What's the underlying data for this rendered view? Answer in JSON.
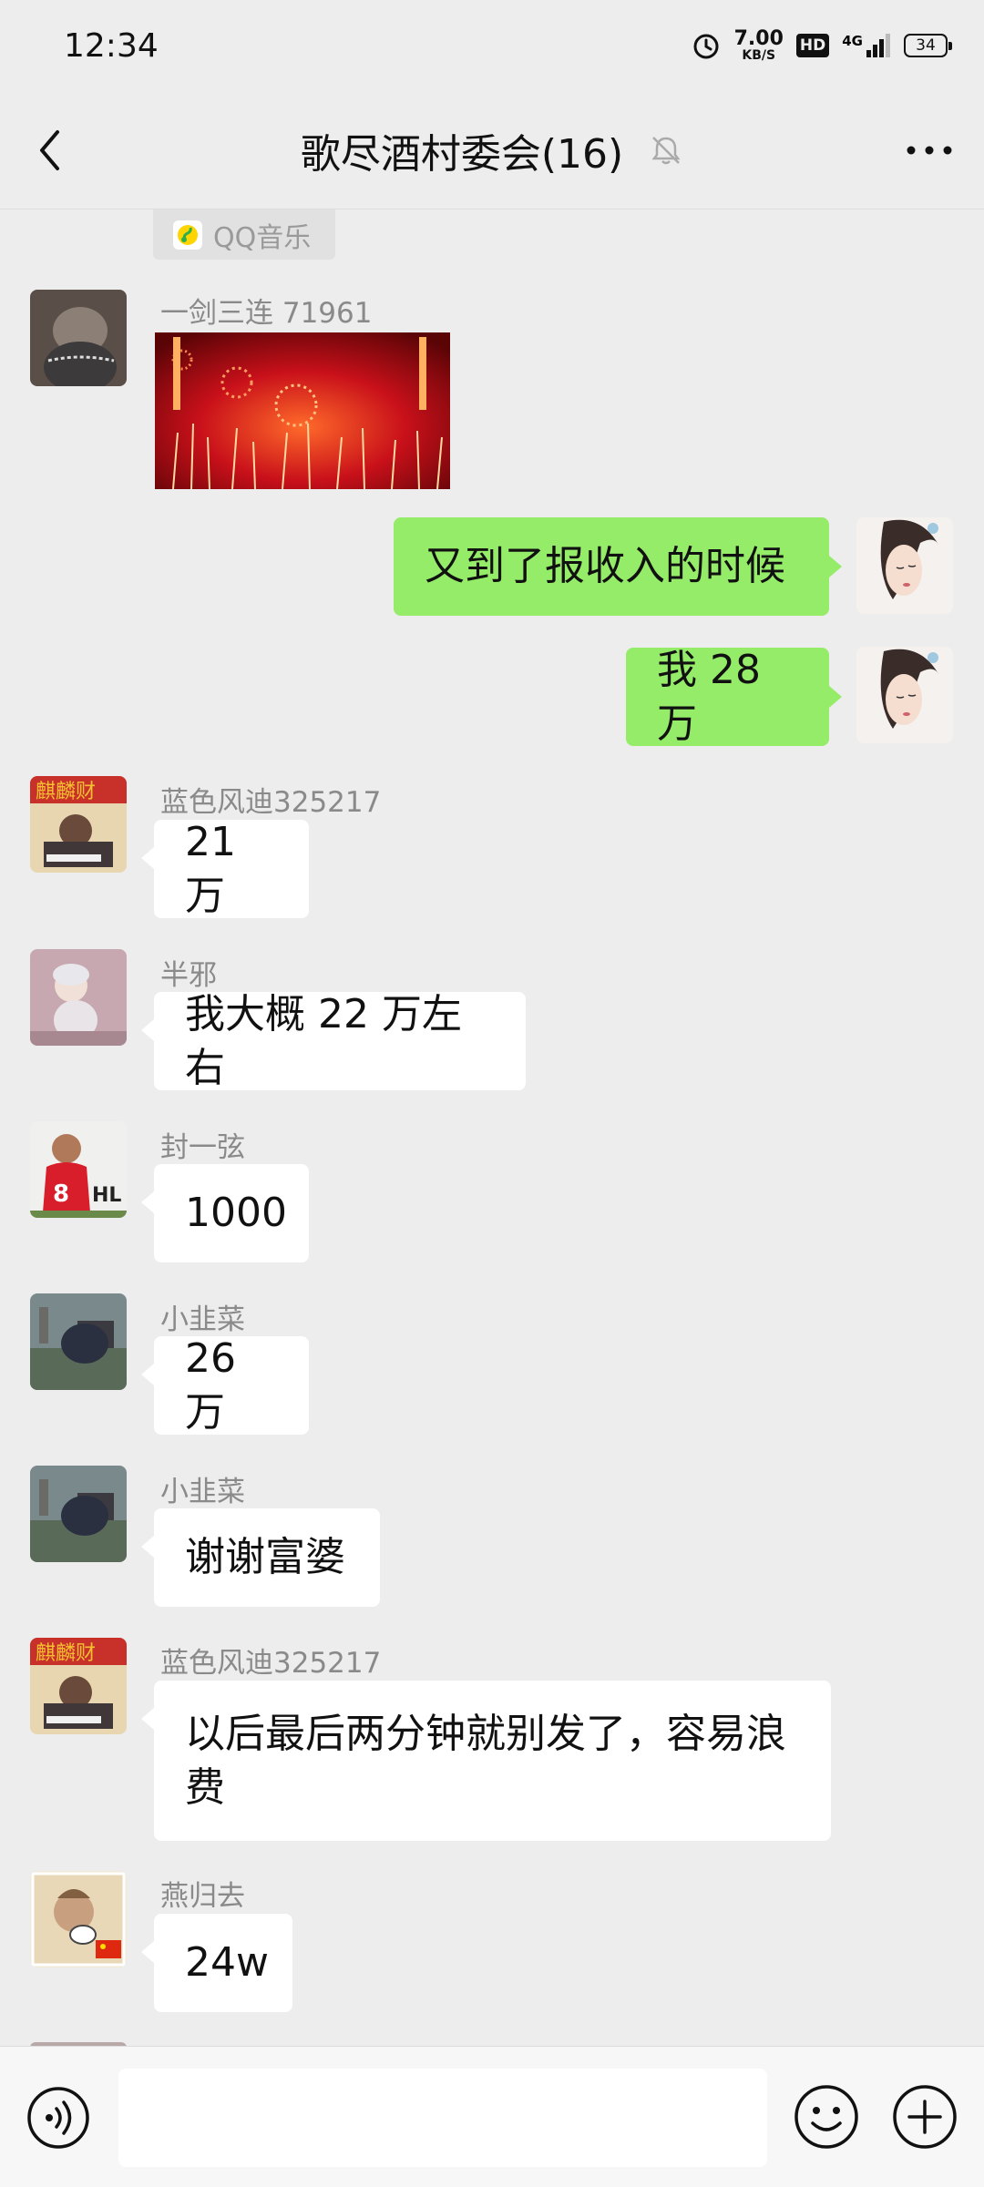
{
  "status": {
    "time": "12:34",
    "speed_value": "7.00",
    "speed_unit": "KB/S",
    "hd": "HD",
    "network": "4G",
    "battery": "34"
  },
  "header": {
    "title": "歌尽酒村委会(16)"
  },
  "music_card": {
    "label": "QQ音乐"
  },
  "messages": [
    {
      "sender": "一剑三连 71961",
      "type": "image"
    },
    {
      "text": "又到了报收入的时候",
      "mine": true
    },
    {
      "text": "我 28 万",
      "mine": true
    },
    {
      "sender": "蓝色风迪325217",
      "text": "21 万"
    },
    {
      "sender": "半邪",
      "text": "我大概 22 万左右"
    },
    {
      "sender": "封一弦",
      "text": "1000"
    },
    {
      "sender": "小韭菜",
      "text": "26 万"
    },
    {
      "sender": "小韭菜",
      "text": "谢谢富婆"
    },
    {
      "sender": "蓝色风迪325217",
      "text": "以后最后两分钟就别发了，容易浪费"
    },
    {
      "sender": "燕归去",
      "text": "24w"
    }
  ],
  "colors": {
    "bg": "#ededed",
    "my_bubble": "#95ec69",
    "other_bubble": "#ffffff"
  }
}
